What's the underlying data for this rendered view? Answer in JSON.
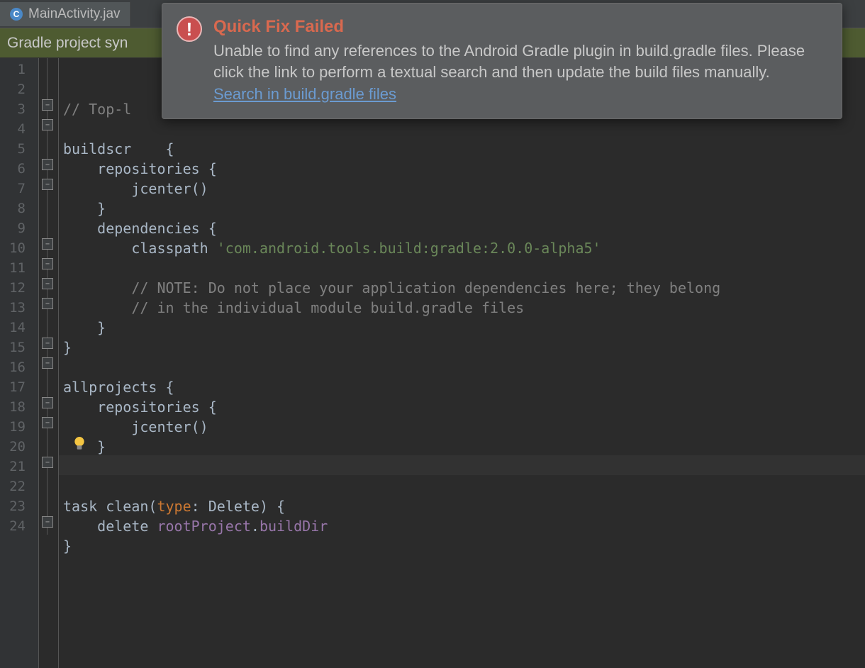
{
  "tab": {
    "icon_letter": "C",
    "label": "MainActivity.jav"
  },
  "banner": {
    "text": "Gradle project syn"
  },
  "gutter": {
    "lines": [
      "1",
      "2",
      "3",
      "4",
      "5",
      "6",
      "7",
      "8",
      "9",
      "10",
      "11",
      "12",
      "13",
      "14",
      "15",
      "16",
      "17",
      "18",
      "19",
      "20",
      "21",
      "22",
      "23",
      "24"
    ]
  },
  "code": {
    "l1_comment": "// Top-l",
    "l3_a": "buildscr",
    "l3_b": "{",
    "l4": "    repositories {",
    "l5": "        jcenter()",
    "l6": "    }",
    "l7": "    dependencies {",
    "l8_a": "        classpath ",
    "l8_str": "'com.android.tools.build:gradle:2.0.0-alpha5'",
    "l10_cm": "        // NOTE: Do not place your application dependencies here; they belong",
    "l11_cm": "        // in the individual module build.gradle files",
    "l12": "    }",
    "l13": "}",
    "l15": "allprojects {",
    "l16": "    repositories {",
    "l17": "        jcenter()",
    "l18": "    }",
    "l19": "}",
    "l21_a": "task clean(",
    "l21_kw": "type",
    "l21_b": ": Delete) {",
    "l22_a": "    delete ",
    "l22_p1": "rootProject",
    "l22_dot": ".",
    "l22_p2": "buildDir",
    "l23": "}"
  },
  "popup": {
    "title": "Quick Fix Failed",
    "message": "Unable to find any references to the Android Gradle plugin in build.gradle files. Please click the link to perform a textual search and then update the build files manually.",
    "link": "Search in build.gradle files"
  },
  "icons": {
    "error": "!",
    "bulb": "bulb-icon"
  },
  "highlight_line": 21
}
